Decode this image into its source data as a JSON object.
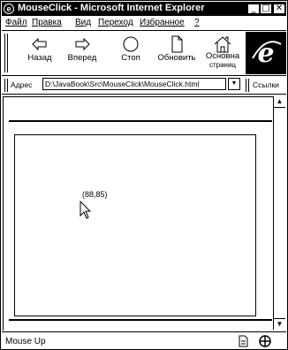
{
  "window": {
    "title": "MouseClick - Microsoft Internet Explorer",
    "app_icon": "ie-icon"
  },
  "window_controls": {
    "minimize": "_",
    "maximize": "□",
    "close": "✕"
  },
  "menu": {
    "items": [
      "Файл",
      "Правка",
      "Вид",
      "Переход",
      "Избранное",
      "?"
    ]
  },
  "toolbar": {
    "back_label": "Назад",
    "forward_label": "Вперед",
    "stop_label": "Стоп",
    "refresh_label": "Обновить",
    "home_label_line1": "Основна",
    "home_label_line2": "страниц"
  },
  "address": {
    "label": "Адрес",
    "value": "D:\\JavaBook\\Src\\MouseClick\\MouseClick.html",
    "links_label": "Ссылки"
  },
  "page": {
    "coords_text": "(88,85)"
  },
  "status": {
    "text": "Mouse Up"
  }
}
